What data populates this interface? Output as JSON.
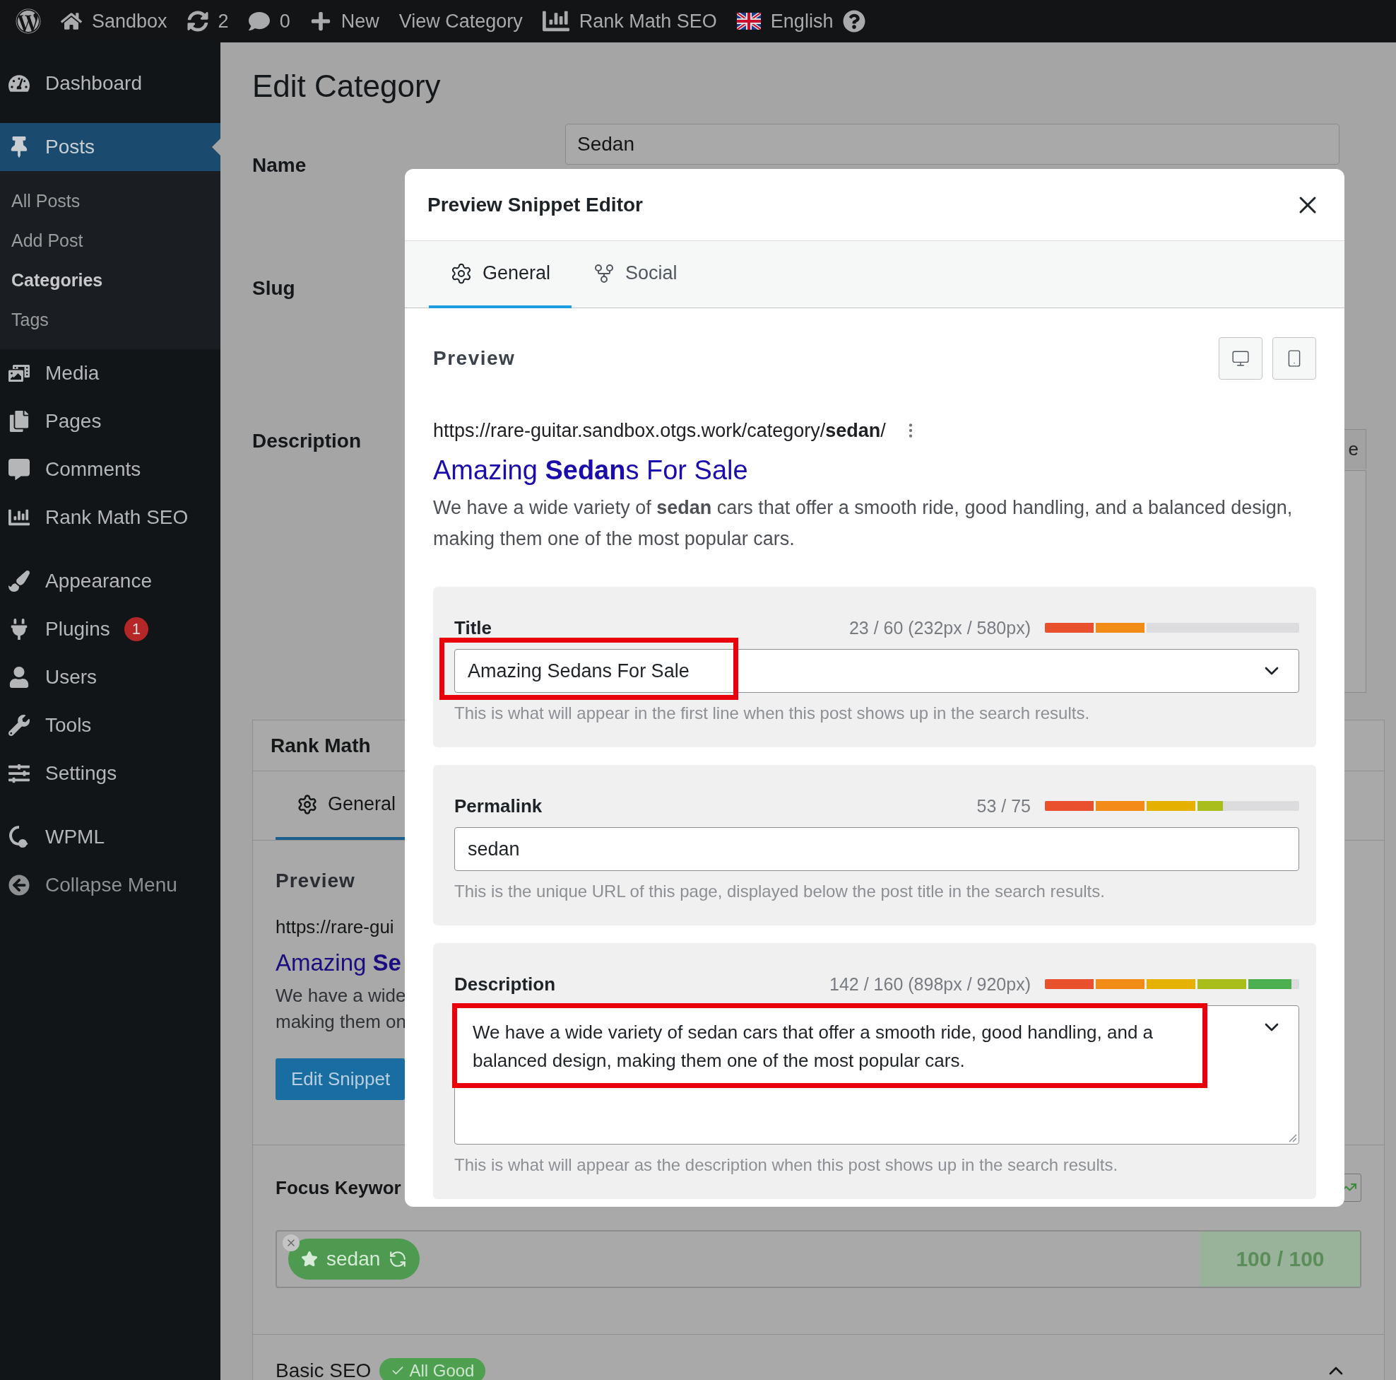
{
  "admin_bar": {
    "items": [
      {
        "text": "Sandbox"
      },
      {
        "text": "2"
      },
      {
        "text": "0"
      },
      {
        "text": "New"
      },
      {
        "text": "View Category"
      },
      {
        "text": "Rank Math SEO"
      },
      {
        "text": "English"
      }
    ]
  },
  "sidebar": {
    "groups": [
      {
        "items": [
          {
            "kind": "menu",
            "label": "Dashboard",
            "selected": false
          }
        ]
      },
      {
        "items": [
          {
            "kind": "menu",
            "label": "Posts",
            "selected": true,
            "children": [
              {
                "label": "All Posts",
                "selected": false
              },
              {
                "label": "Add Post",
                "selected": false
              },
              {
                "label": "Categories",
                "selected": true
              },
              {
                "label": "Tags",
                "selected": false
              }
            ]
          },
          {
            "kind": "menu",
            "label": "Media",
            "selected": false
          },
          {
            "kind": "menu",
            "label": "Pages",
            "selected": false
          },
          {
            "kind": "menu",
            "label": "Comments",
            "selected": false
          },
          {
            "kind": "menu",
            "label": "Rank Math SEO",
            "selected": false
          }
        ]
      },
      {
        "items": [
          {
            "kind": "menu",
            "label": "Appearance",
            "selected": false
          },
          {
            "kind": "menu",
            "label": "Plugins",
            "selected": false,
            "badge": "1"
          },
          {
            "kind": "menu",
            "label": "Users",
            "selected": false
          },
          {
            "kind": "menu",
            "label": "Tools",
            "selected": false
          },
          {
            "kind": "menu",
            "label": "Settings",
            "selected": false
          }
        ]
      },
      {
        "items": [
          {
            "kind": "menu",
            "label": "WPML",
            "selected": false
          },
          {
            "kind": "collapse",
            "label": "Collapse Menu",
            "selected": false
          }
        ]
      }
    ]
  },
  "page": {
    "title": "Edit Category",
    "form": {
      "name": {
        "label": "Name",
        "value": "Sedan"
      },
      "slug": {
        "label": "Slug"
      },
      "description": {
        "label": "Description",
        "editor_tab": "e"
      }
    }
  },
  "rank_math_panel": {
    "title": "Rank Math",
    "tab": "General",
    "preview_heading": "Preview",
    "url": "https://rare-gui",
    "title_link": "Amazing **Se**",
    "description_lines": [
      "We have a wide",
      "making them on"
    ],
    "button": "Edit Snippet",
    "focus_keyword_label": "Focus Keywor",
    "keywords": [
      {
        "text": "sedan"
      }
    ],
    "score": "100 / 100",
    "basic_seo": "Basic SEO",
    "badge": "All Good"
  },
  "modal": {
    "title": "Preview Snippet Editor",
    "tabs": [
      {
        "label": "General",
        "selected": true
      },
      {
        "label": "Social",
        "selected": false
      }
    ],
    "preview": {
      "heading": "Preview",
      "url": "https://rare-guitar.sandbox.otgs.work/category/**sedan**/",
      "title": "Amazing **Sedan**s For Sale",
      "description": "We have a wide variety of **sedan** cars that offer a smooth ride, good handling, and a balanced design, making them one of the most popular cars."
    },
    "fields": [
      {
        "kind": "select",
        "label": "Title",
        "counter": "23 / 60 (232px / 580px)",
        "level": 0.4,
        "value": "Amazing Sedans For Sale",
        "help": "This is what will appear in the first line when this post shows up in the search results.",
        "highlighted": true
      },
      {
        "kind": "input",
        "label": "Permalink",
        "counter": "53 / 75",
        "level": 0.7,
        "value": "sedan",
        "help": "This is the unique URL of this page, displayed below the post title in the search results.",
        "highlighted": false
      },
      {
        "kind": "textarea",
        "label": "Description",
        "counter": "142 / 160 (898px / 920px)",
        "level": 0.97,
        "value": "We have a wide variety of sedan cars that offer a smooth ride, good handling, and a balanced design, making them one of the most popular cars.",
        "help": "This is what will appear as the description when this post shows up in the search results.",
        "highlighted": true
      }
    ]
  }
}
